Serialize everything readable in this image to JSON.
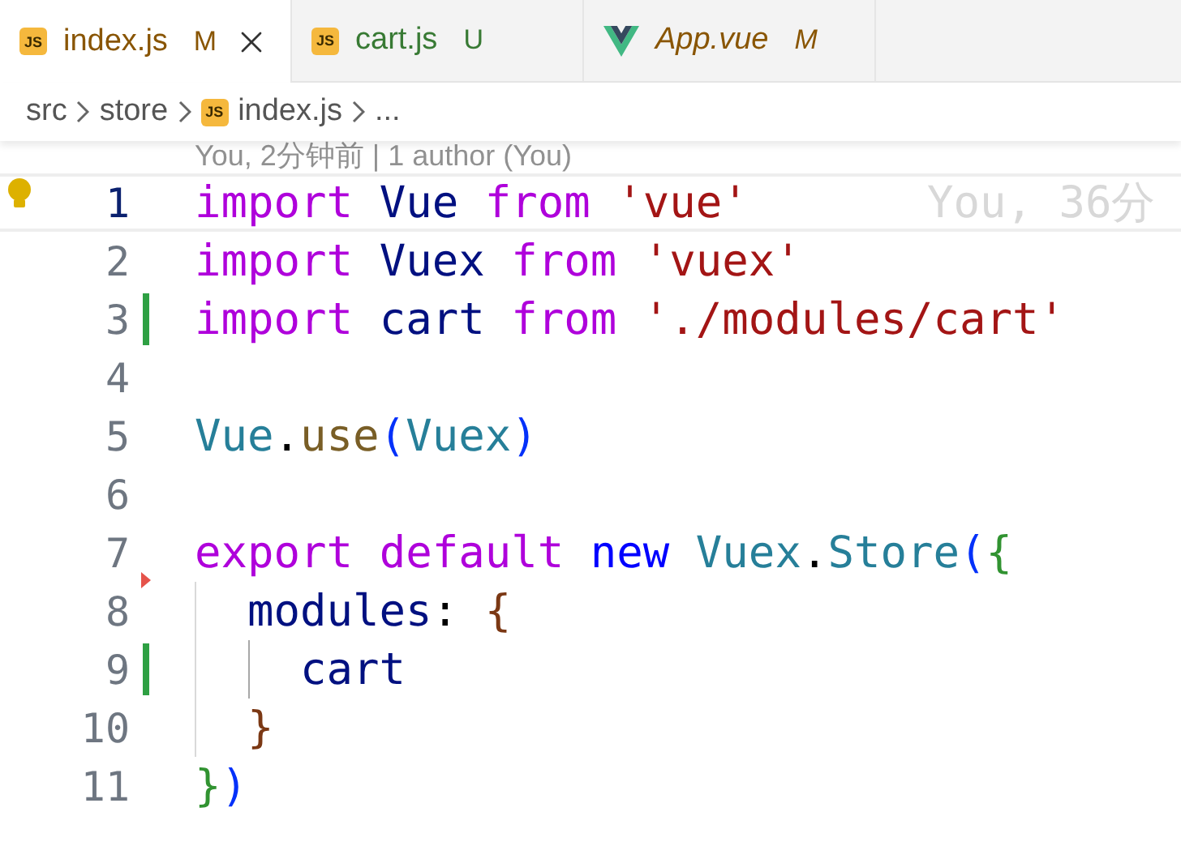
{
  "tabs": [
    {
      "icon": {
        "kind": "js",
        "text": "JS"
      },
      "label": "index.js",
      "badge": "M",
      "color": "#895503",
      "selected": true,
      "preview": false
    },
    {
      "icon": {
        "kind": "js",
        "text": "JS"
      },
      "label": "cart.js",
      "badge": "U",
      "color": "#387a34",
      "selected": false,
      "preview": false
    },
    {
      "icon": {
        "kind": "vue"
      },
      "label": "App.vue",
      "badge": "M",
      "color": "#895503",
      "selected": false,
      "preview": true
    }
  ],
  "breadcrumb": [
    {
      "label": "src"
    },
    {
      "label": "store"
    },
    {
      "label": "index.js",
      "icon": {
        "kind": "js",
        "text": "JS"
      }
    },
    {
      "label": "..."
    }
  ],
  "codelens": "You, 2分钟前 | 1 author (You)",
  "lines": [
    {
      "number": "1",
      "current": true,
      "lightbulb": true,
      "added": false,
      "deleted": false,
      "blame": "You, 36分",
      "tokens": [
        {
          "kind": "keyword",
          "text": "import"
        },
        {
          "kind": "space"
        },
        {
          "kind": "variable",
          "text": "Vue"
        },
        {
          "kind": "space"
        },
        {
          "kind": "keyword",
          "text": "from"
        },
        {
          "kind": "space"
        },
        {
          "kind": "string",
          "text": "'vue'"
        }
      ]
    },
    {
      "number": "2",
      "current": false,
      "lightbulb": false,
      "added": false,
      "deleted": false,
      "tokens": [
        {
          "kind": "keyword",
          "text": "import"
        },
        {
          "kind": "space"
        },
        {
          "kind": "variable",
          "text": "Vuex"
        },
        {
          "kind": "space"
        },
        {
          "kind": "keyword",
          "text": "from"
        },
        {
          "kind": "space"
        },
        {
          "kind": "string",
          "text": "'vuex'"
        }
      ]
    },
    {
      "number": "3",
      "current": false,
      "lightbulb": false,
      "added": true,
      "deleted": false,
      "tokens": [
        {
          "kind": "keyword",
          "text": "import"
        },
        {
          "kind": "space"
        },
        {
          "kind": "variable",
          "text": "cart"
        },
        {
          "kind": "space"
        },
        {
          "kind": "keyword",
          "text": "from"
        },
        {
          "kind": "space"
        },
        {
          "kind": "string",
          "text": "'./modules/cart'"
        }
      ]
    },
    {
      "number": "4",
      "current": false,
      "lightbulb": false,
      "added": false,
      "deleted": false
    },
    {
      "number": "5",
      "current": false,
      "lightbulb": false,
      "added": false,
      "deleted": false,
      "tokens": [
        {
          "kind": "class",
          "text": "Vue"
        },
        {
          "kind": "punct",
          "text": "."
        },
        {
          "kind": "function",
          "text": "use"
        },
        {
          "kind": "paren",
          "text": "("
        },
        {
          "kind": "class",
          "text": "Vuex"
        },
        {
          "kind": "paren",
          "text": ")"
        }
      ]
    },
    {
      "number": "6",
      "current": false,
      "lightbulb": false,
      "added": false,
      "deleted": false
    },
    {
      "number": "7",
      "current": false,
      "lightbulb": false,
      "added": false,
      "deleted": false,
      "tokens": [
        {
          "kind": "keyword",
          "text": "export"
        },
        {
          "kind": "space"
        },
        {
          "kind": "keyword",
          "text": "default"
        },
        {
          "kind": "space"
        },
        {
          "kind": "storage",
          "text": "new"
        },
        {
          "kind": "space"
        },
        {
          "kind": "class",
          "text": "Vuex"
        },
        {
          "kind": "punct",
          "text": "."
        },
        {
          "kind": "class",
          "text": "Store"
        },
        {
          "kind": "paren",
          "text": "("
        },
        {
          "kind": "brace1",
          "text": "{"
        }
      ]
    },
    {
      "number": "8",
      "current": false,
      "lightbulb": false,
      "added": false,
      "deleted": true,
      "tokens": [
        {
          "kind": "indent"
        },
        {
          "kind": "variable",
          "text": "modules"
        },
        {
          "kind": "punct",
          "text": ":"
        },
        {
          "kind": "space"
        },
        {
          "kind": "brace2",
          "text": "{"
        }
      ]
    },
    {
      "number": "9",
      "current": false,
      "lightbulb": false,
      "added": true,
      "deleted": false,
      "tokens": [
        {
          "kind": "indent"
        },
        {
          "kind": "indent-active"
        },
        {
          "kind": "variable",
          "text": "cart"
        }
      ]
    },
    {
      "number": "10",
      "current": false,
      "lightbulb": false,
      "added": false,
      "deleted": false,
      "tokens": [
        {
          "kind": "indent"
        },
        {
          "kind": "brace2",
          "text": "}"
        }
      ]
    },
    {
      "number": "11",
      "current": false,
      "lightbulb": false,
      "added": false,
      "deleted": false,
      "tokens": [
        {
          "kind": "brace1",
          "text": "}"
        },
        {
          "kind": "paren",
          "text": ")"
        }
      ]
    }
  ]
}
